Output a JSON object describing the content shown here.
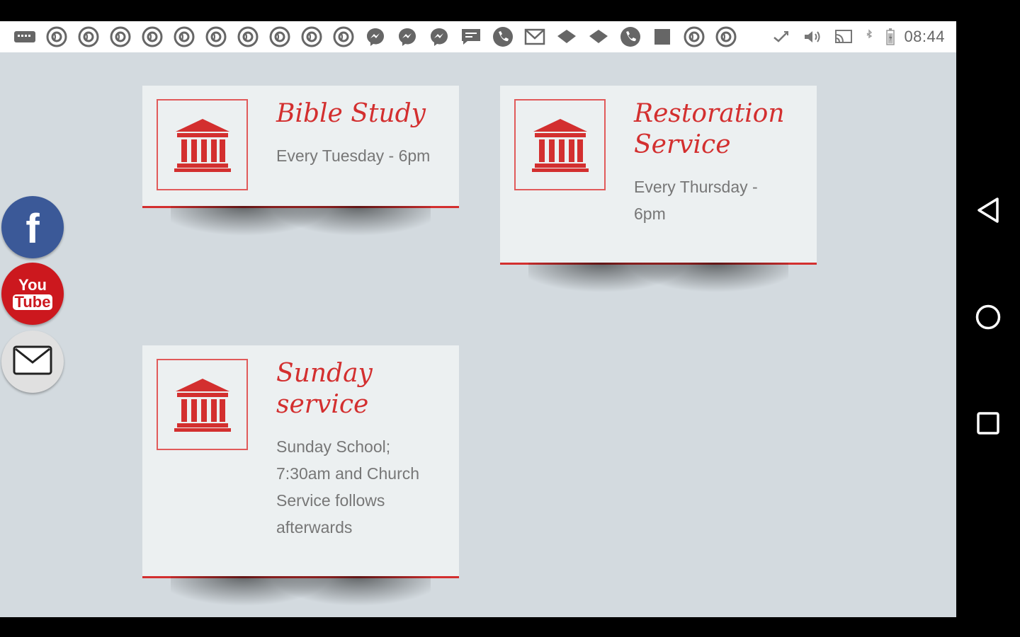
{
  "status_bar": {
    "time": "08:44",
    "notification_icons": [
      "keyboard-icon",
      "app-icon",
      "app-icon",
      "app-icon",
      "app-icon",
      "app-icon",
      "app-icon",
      "app-icon",
      "app-icon",
      "app-icon",
      "app-icon",
      "messenger-icon",
      "messenger-icon",
      "messenger-icon",
      "sms-icon",
      "phone-icon",
      "gmail-icon",
      "chat-bubble-icon",
      "chat-bubble-icon",
      "phone-icon",
      "stop-square-icon",
      "app-icon",
      "app-icon"
    ],
    "system_icons": [
      "signal-icon",
      "volume-icon",
      "cast-icon",
      "bluetooth-icon",
      "battery-icon"
    ]
  },
  "events": [
    {
      "title": "Bible Study",
      "description": "Every Tuesday - 6pm",
      "icon": "institution-icon"
    },
    {
      "title": "Restoration Service",
      "description": "Every Thursday - 6pm",
      "icon": "institution-icon"
    },
    {
      "title": "Sunday service",
      "description": "Sunday School; 7:30am and Church Service follows afterwards",
      "icon": "institution-icon"
    }
  ],
  "social": {
    "facebook": {
      "icon": "facebook-icon",
      "color": "#3b5998",
      "glyph": "f"
    },
    "youtube": {
      "icon": "youtube-icon",
      "color": "#cc181e",
      "line1": "You",
      "line2": "Tube"
    },
    "email": {
      "icon": "mail-icon",
      "color": "#e0e0e0"
    }
  },
  "navigation": [
    "back-icon",
    "home-icon",
    "recents-icon"
  ],
  "colors": {
    "accent": "#d32f2f",
    "background": "#d3dadf",
    "card": "#ecf0f1"
  }
}
